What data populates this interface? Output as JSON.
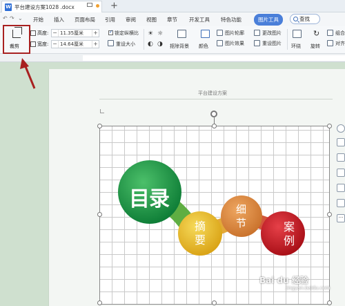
{
  "tab": {
    "title": "平台建设方案1028 .docx",
    "icon_letter": "W"
  },
  "menu": {
    "items": [
      "开始",
      "插入",
      "页面布局",
      "引用",
      "审阅",
      "视图",
      "章节",
      "开发工具",
      "特色功能"
    ],
    "active": "图片工具",
    "search": "查找"
  },
  "ribbon": {
    "crop": "裁剪",
    "height_label": "高度:",
    "height_value": "11.35厘米",
    "width_label": "宽度:",
    "width_value": "14.64厘米",
    "lock_ratio": "锁定纵横比",
    "reset_size": "重设大小",
    "remove_bg": "抠除背景",
    "color": "颜色",
    "outline": "图片轮廓",
    "effect": "图片效果",
    "change_pic": "更改图片",
    "reset_pic": "重设图片",
    "wrap": "环绕",
    "rotate": "旋转",
    "combine": "组合",
    "align": "对齐"
  },
  "document": {
    "header": "平台建设方案"
  },
  "diagram": {
    "main": "目录",
    "items": [
      "摘要",
      "细节",
      "案例"
    ]
  },
  "watermark": {
    "text": "Bai du 经验",
    "sub": "jingyan.baidu.com"
  },
  "colors": {
    "accent": "#4a7fd9",
    "highlight": "#a82020",
    "green": "#1a9a48",
    "yellow": "#e8b820",
    "orange": "#d98a3c",
    "red": "#c0141c"
  }
}
